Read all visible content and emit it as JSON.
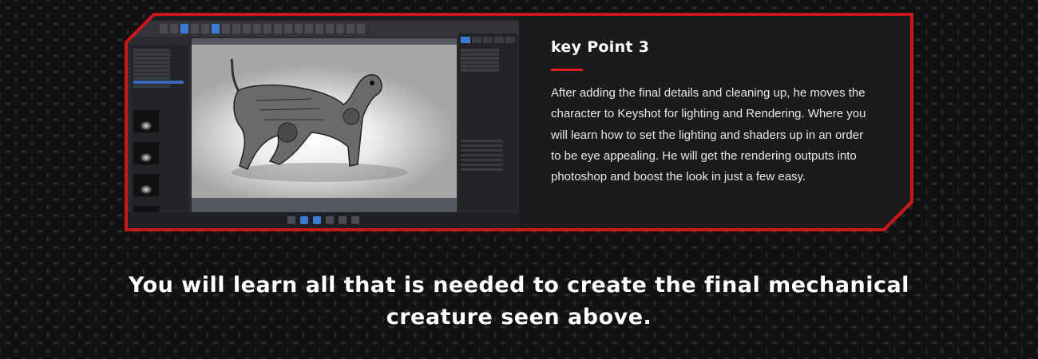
{
  "card": {
    "title": "key Point 3",
    "body": "After adding the final details and cleaning up, he moves the character to Keyshot for lighting and Rendering. Where you will learn how to set the lighting and shaders up in an order to be eye appealing. He will get the rendering outputs into photoshop and boost the look in just a few easy.",
    "accent_color": "#e0201c",
    "border_color": "#c41a1a"
  },
  "screenshot": {
    "description_icon": "keyshot-ui-screenshot",
    "viewport_icon": "mechanical-dog-render"
  },
  "footer": {
    "line1": "You will learn all that is needed to create the final mechanical",
    "line2": "creature seen above."
  }
}
